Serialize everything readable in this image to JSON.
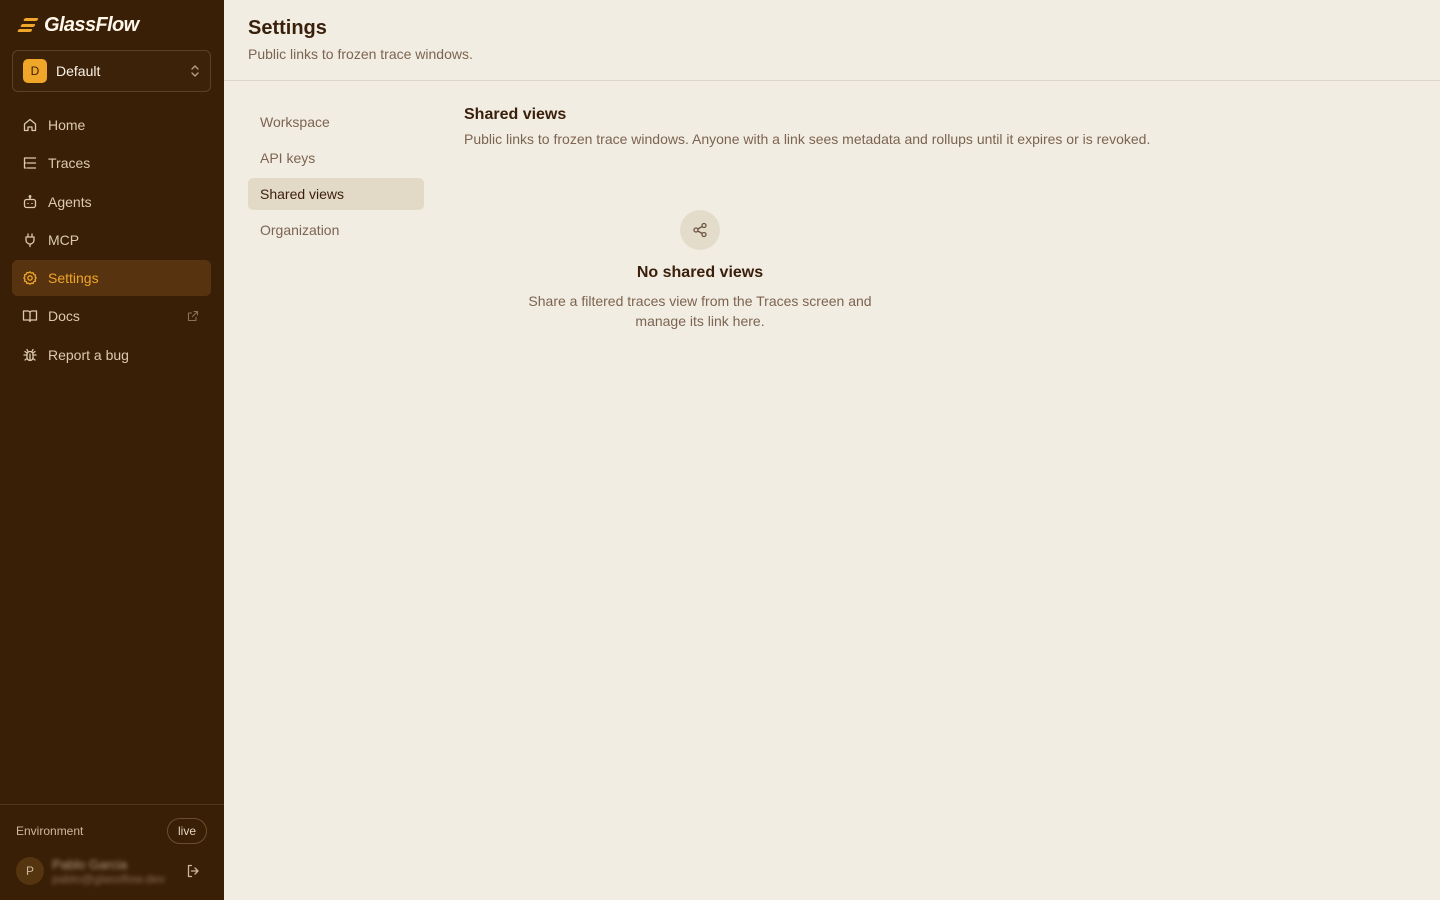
{
  "app": {
    "name": "GlassFlow"
  },
  "workspace": {
    "initial": "D",
    "name": "Default"
  },
  "nav": [
    {
      "label": "Home",
      "icon": "home-icon"
    },
    {
      "label": "Traces",
      "icon": "list-tree-icon"
    },
    {
      "label": "Agents",
      "icon": "bot-icon"
    },
    {
      "label": "MCP",
      "icon": "plug-icon"
    },
    {
      "label": "Settings",
      "icon": "gear-icon",
      "active": true
    },
    {
      "label": "Docs",
      "icon": "book-icon",
      "external": true
    },
    {
      "label": "Report a bug",
      "icon": "bug-icon"
    }
  ],
  "footer": {
    "env_label": "Environment",
    "env_value": "live",
    "user_initial": "P",
    "user_name": "Pablo Garcia",
    "user_email": "pablo@glassflow.dev"
  },
  "page": {
    "title": "Settings",
    "subtitle": "Public links to frozen trace windows."
  },
  "subnav": [
    {
      "label": "Workspace"
    },
    {
      "label": "API keys"
    },
    {
      "label": "Shared views",
      "active": true
    },
    {
      "label": "Organization"
    }
  ],
  "section": {
    "title": "Shared views",
    "description": "Public links to frozen trace windows. Anyone with a link sees metadata and rollups until it expires or is revoked."
  },
  "empty_state": {
    "icon": "share-icon",
    "title": "No shared views",
    "description": "Share a filtered traces view from the Traces screen and manage its link here."
  },
  "colors": {
    "sidebar_bg": "#3a1f07",
    "accent": "#f0a629",
    "main_bg": "#f1ede3"
  }
}
